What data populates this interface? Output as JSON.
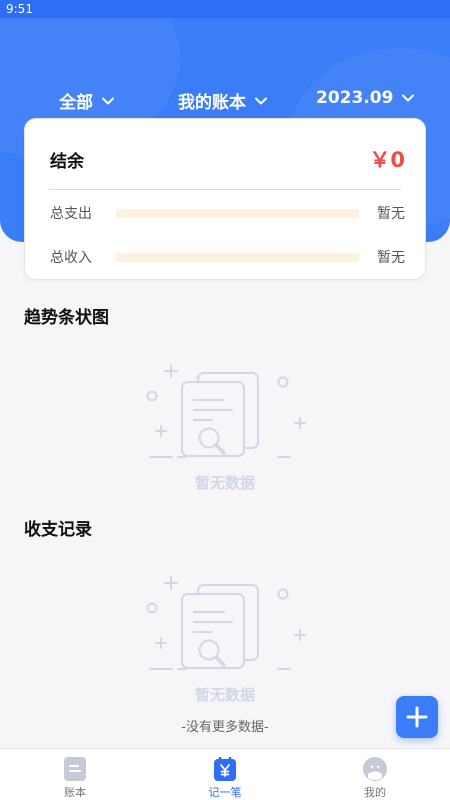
{
  "status_bar": {
    "time": "9:51"
  },
  "filters": {
    "category": "全部",
    "account": "我的账本",
    "month": "2023.09"
  },
  "summary": {
    "balance_label": "结余",
    "balance_value": "￥0",
    "expense_label": "总支出",
    "expense_value": "暂无",
    "income_label": "总收入",
    "income_value": "暂无"
  },
  "sections": {
    "trend_title": "趋势条状图",
    "trend_empty": "暂无数据",
    "records_title": "收支记录",
    "records_empty": "暂无数据",
    "no_more": "-没有更多数据-"
  },
  "tabbar": {
    "items": [
      {
        "label": "账本",
        "icon": "ledger-icon"
      },
      {
        "label": "记一笔",
        "icon": "record-yen-icon",
        "active": true
      },
      {
        "label": "我的",
        "icon": "profile-face-icon"
      }
    ]
  },
  "colors": {
    "primary": "#3a7df7",
    "balance_red": "#f04a4a",
    "empty_gray": "#d2d6e6"
  }
}
